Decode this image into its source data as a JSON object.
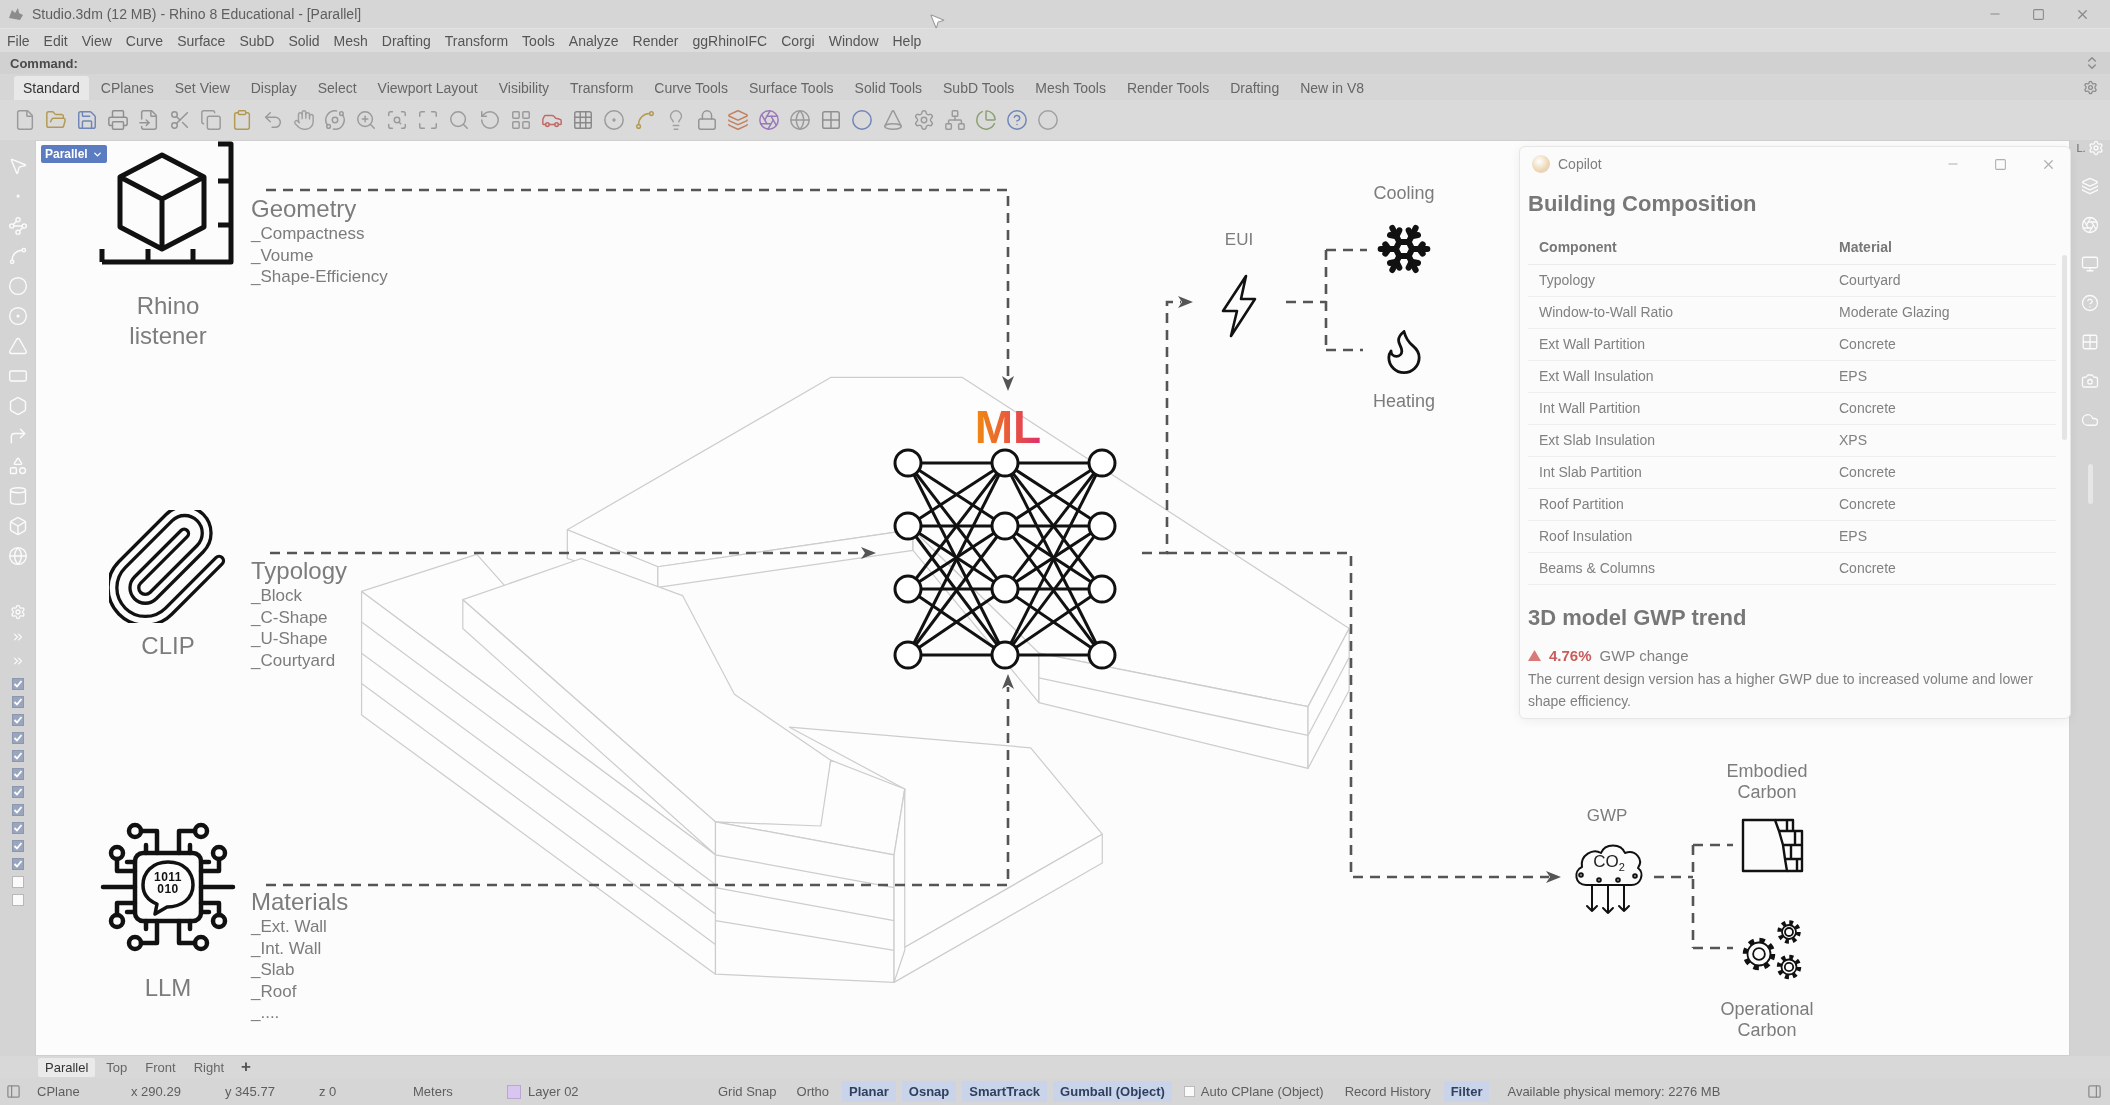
{
  "window": {
    "title": "Studio.3dm (12 MB) - Rhino 8 Educational - [Parallel]"
  },
  "menu": [
    "File",
    "Edit",
    "View",
    "Curve",
    "Surface",
    "SubD",
    "Solid",
    "Mesh",
    "Drafting",
    "Transform",
    "Tools",
    "Analyze",
    "Render",
    "ggRhinoIFC",
    "Corgi",
    "Window",
    "Help"
  ],
  "command_line": {
    "label": "Command:"
  },
  "toolbar_tabs": [
    {
      "label": "Standard",
      "selected": true
    },
    {
      "label": "CPlanes",
      "selected": false
    },
    {
      "label": "Set View",
      "selected": false
    },
    {
      "label": "Display",
      "selected": false
    },
    {
      "label": "Select",
      "selected": false
    },
    {
      "label": "Viewport Layout",
      "selected": false
    },
    {
      "label": "Visibility",
      "selected": false
    },
    {
      "label": "Transform",
      "selected": false
    },
    {
      "label": "Curve Tools",
      "selected": false
    },
    {
      "label": "Surface Tools",
      "selected": false
    },
    {
      "label": "Solid Tools",
      "selected": false
    },
    {
      "label": "SubD Tools",
      "selected": false
    },
    {
      "label": "Mesh Tools",
      "selected": false
    },
    {
      "label": "Render Tools",
      "selected": false
    },
    {
      "label": "Drafting",
      "selected": false
    },
    {
      "label": "New in V8",
      "selected": false
    }
  ],
  "side_checkboxes": [
    {
      "checked": true
    },
    {
      "checked": true
    },
    {
      "checked": true
    },
    {
      "checked": true
    },
    {
      "checked": true
    },
    {
      "checked": true
    },
    {
      "checked": true
    },
    {
      "checked": true
    },
    {
      "checked": true
    },
    {
      "checked": true
    },
    {
      "checked": true
    },
    {
      "checked": false
    },
    {
      "checked": false
    }
  ],
  "dock": {
    "tab_label": "L."
  },
  "viewport": {
    "label": "Parallel"
  },
  "diagram": {
    "inputs": [
      {
        "kind": "rhino",
        "name": "Rhino listener",
        "category": "Geometry",
        "features": [
          "_Compactness",
          "_Voume",
          "_Shape-Efficiency"
        ]
      },
      {
        "kind": "clip",
        "name": "CLIP",
        "category": "Typology",
        "features": [
          "_Block",
          "_C-Shape",
          "_U-Shape",
          "_Courtyard"
        ]
      },
      {
        "kind": "llm",
        "name": "LLM",
        "icon_text": [
          "1011",
          "010"
        ],
        "category": "Materials",
        "features": [
          "_Ext. Wall",
          "_Int. Wall",
          "_Slab",
          "_Roof",
          "_...."
        ]
      }
    ],
    "model": {
      "label": "ML"
    },
    "outputs": [
      {
        "kind": "energy",
        "label": "EUI",
        "branches": [
          {
            "kind": "cooling",
            "label": "Cooling"
          },
          {
            "kind": "heating",
            "label": "Heating"
          }
        ]
      },
      {
        "kind": "carbon",
        "label": "GWP",
        "icon_text": "CO$_{2}$",
        "branches": [
          {
            "kind": "embodied",
            "label": "Embodied Carbon"
          },
          {
            "kind": "operational",
            "label": "Operational Carbon"
          }
        ]
      }
    ]
  },
  "copilot": {
    "title": "Copilot",
    "heading": "Building Composition",
    "columns": [
      "Component",
      "Material"
    ],
    "rows": [
      [
        "Typology",
        "Courtyard"
      ],
      [
        "Window-to-Wall Ratio",
        "Moderate Glazing"
      ],
      [
        "Ext Wall Partition",
        "Concrete"
      ],
      [
        "Ext Wall Insulation",
        "EPS"
      ],
      [
        "Int Wall Partition",
        "Concrete"
      ],
      [
        "Ext Slab Insulation",
        "XPS"
      ],
      [
        "Int Slab Partition",
        "Concrete"
      ],
      [
        "Roof Partition",
        "Concrete"
      ],
      [
        "Roof Insulation",
        "EPS"
      ],
      [
        "Beams & Columns",
        "Concrete"
      ]
    ],
    "trend_heading": "3D model GWP trend",
    "change": {
      "increase": true,
      "value": "4.76%",
      "label": "GWP change"
    },
    "summary": "The current design version has a higher GWP due to increased volume and lower shape efficiency."
  },
  "viewport_tabs": [
    {
      "label": "Parallel",
      "selected": true
    },
    {
      "label": "Top",
      "selected": false
    },
    {
      "label": "Front",
      "selected": false
    },
    {
      "label": "Right",
      "selected": false
    }
  ],
  "add_tab": "+",
  "status_bar": {
    "fields": [
      "CPlane",
      "x 290.29",
      "y 345.77",
      "z 0",
      "Meters"
    ],
    "layer": "Layer 02",
    "items": [
      {
        "kind": "toggle",
        "label": "Grid Snap",
        "on": false
      },
      {
        "kind": "toggle",
        "label": "Ortho",
        "on": false
      },
      {
        "kind": "toggle",
        "label": "Planar",
        "on": true
      },
      {
        "kind": "toggle",
        "label": "Osnap",
        "on": true
      },
      {
        "kind": "toggle",
        "label": "SmartTrack",
        "on": true
      },
      {
        "kind": "toggle",
        "label": "Gumball (Object)",
        "on": true
      },
      {
        "kind": "checkbox",
        "label": "Auto CPlane (Object)",
        "checked": false
      },
      {
        "kind": "toggle",
        "label": "Record History",
        "on": false
      },
      {
        "kind": "toggle",
        "label": "Filter",
        "on": true
      }
    ],
    "memory": "Available physical memory: 2276 MB"
  }
}
